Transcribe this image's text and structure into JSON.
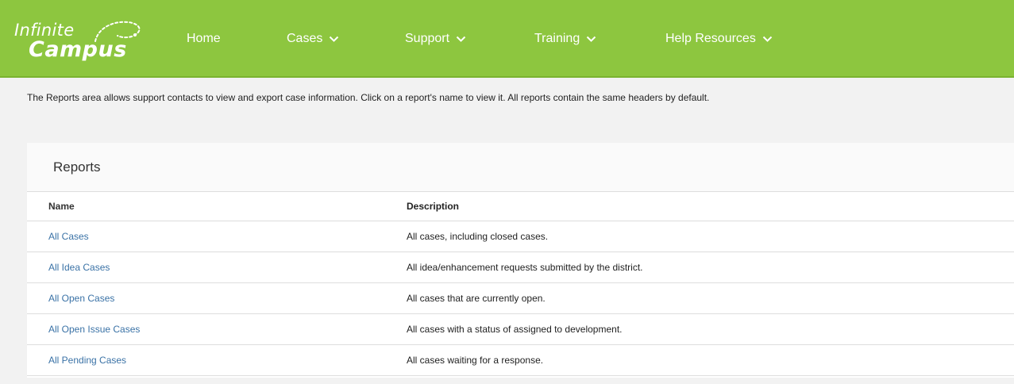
{
  "brand": {
    "line1": "Infinite",
    "line2": "Campus",
    "color": "#8dc63f"
  },
  "nav": [
    {
      "label": "Home",
      "has_menu": false
    },
    {
      "label": "Cases",
      "has_menu": true
    },
    {
      "label": "Support",
      "has_menu": true
    },
    {
      "label": "Training",
      "has_menu": true
    },
    {
      "label": "Help Resources",
      "has_menu": true
    }
  ],
  "intro_text": "The Reports area allows support contacts to view and export case information. Click on a report's name to view it. All reports contain the same headers by default.",
  "reports": {
    "title": "Reports",
    "columns": [
      "Name",
      "Description"
    ],
    "rows": [
      {
        "name": "All Cases",
        "description": "All cases, including closed cases."
      },
      {
        "name": "All Idea Cases",
        "description": "All idea/enhancement requests submitted by the district."
      },
      {
        "name": "All Open Cases",
        "description": "All cases that are currently open."
      },
      {
        "name": "All Open Issue Cases",
        "description": "All cases with a status of assigned to development."
      },
      {
        "name": "All Pending Cases",
        "description": "All cases waiting for a response."
      }
    ]
  },
  "colors": {
    "link": "#3a72a6",
    "header_bg": "#8dc63f",
    "page_bg": "#f2f2f2"
  }
}
